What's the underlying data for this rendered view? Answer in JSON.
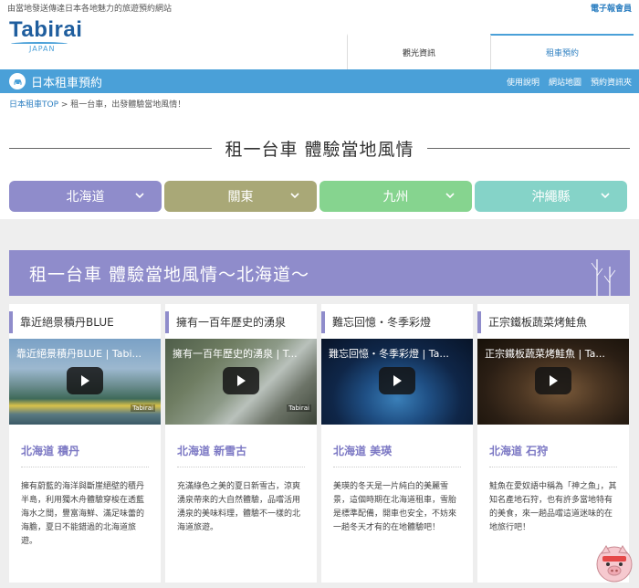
{
  "topbar": {
    "tagline": "由當地發送傳達日本各地魅力的旅遊預約網站",
    "member_link": "電子報會員"
  },
  "logo": {
    "brand": "Tabirai",
    "sub": "JAPAN"
  },
  "nav": {
    "tabs": [
      {
        "label": "觀光資訊"
      },
      {
        "label": "租車預約"
      }
    ]
  },
  "bluebar": {
    "title": "日本租車預約",
    "links": [
      "使用說明",
      "網站地圖",
      "預約資訊夾"
    ]
  },
  "breadcrumb": {
    "home": "日本租車TOP",
    "sep": " > ",
    "current": "租一台車，出發體驗當地風情！"
  },
  "hero": {
    "title": "租一台車 體驗當地風情"
  },
  "regions": [
    {
      "label": "北海道",
      "color": "#8f8ccb"
    },
    {
      "label": "關東",
      "color": "#a9a877"
    },
    {
      "label": "九州",
      "color": "#86d48f"
    },
    {
      "label": "沖繩縣",
      "color": "#85d3c8"
    }
  ],
  "banner": {
    "title": "租一台車 體驗當地風情～北海道～"
  },
  "cards": [
    {
      "title": "靠近絕景積丹BLUE",
      "video_title": "靠近絕景積丹BLUE | Tabi...",
      "watermark": "Tabirai",
      "location": "北海道 積丹",
      "desc": "擁有蔚藍的海洋與斷崖絕壁的積丹半島，利用獨木舟體驗穿梭在透藍海水之間，豐富海鮮、滿足味蕾的海膽，夏日不能錯過的北海道旅遊。"
    },
    {
      "title": "擁有一百年歷史的湧泉",
      "video_title": "擁有一百年歷史的湧泉 | T...",
      "watermark": "Tabirai",
      "location": "北海道 新雪古",
      "desc": "充滿綠色之美的夏日新雪古，涼爽湧泉帶來的大自然體驗，品嚐活用湧泉的美味料理，體驗不一樣的北海道旅遊。"
    },
    {
      "title": "難忘回憶・冬季彩燈",
      "video_title": "難忘回憶・冬季彩燈 | Ta...",
      "watermark": "",
      "location": "北海道 美瑛",
      "desc": "美瑛的冬天是一片純白的美麗雪景，這個時期在北海道租車，雪胎是標準配備，開車也安全，不妨來一趟冬天才有的在地體驗吧！"
    },
    {
      "title": "正宗鐵板蔬菜烤鮭魚",
      "video_title": "正宗鐵板蔬菜烤鮭魚 | Ta...",
      "watermark": "",
      "location": "北海道 石狩",
      "desc": "鮭魚在愛奴語中稱為「神之魚」，其知名產地石狩，也有許多當地特有的美食，來一趟品嚐這道迷味的在地旅行吧！"
    }
  ],
  "colors": {
    "accent": "#4aa0d8",
    "purple": "#8f8ccb",
    "link": "#2d7fc1"
  }
}
